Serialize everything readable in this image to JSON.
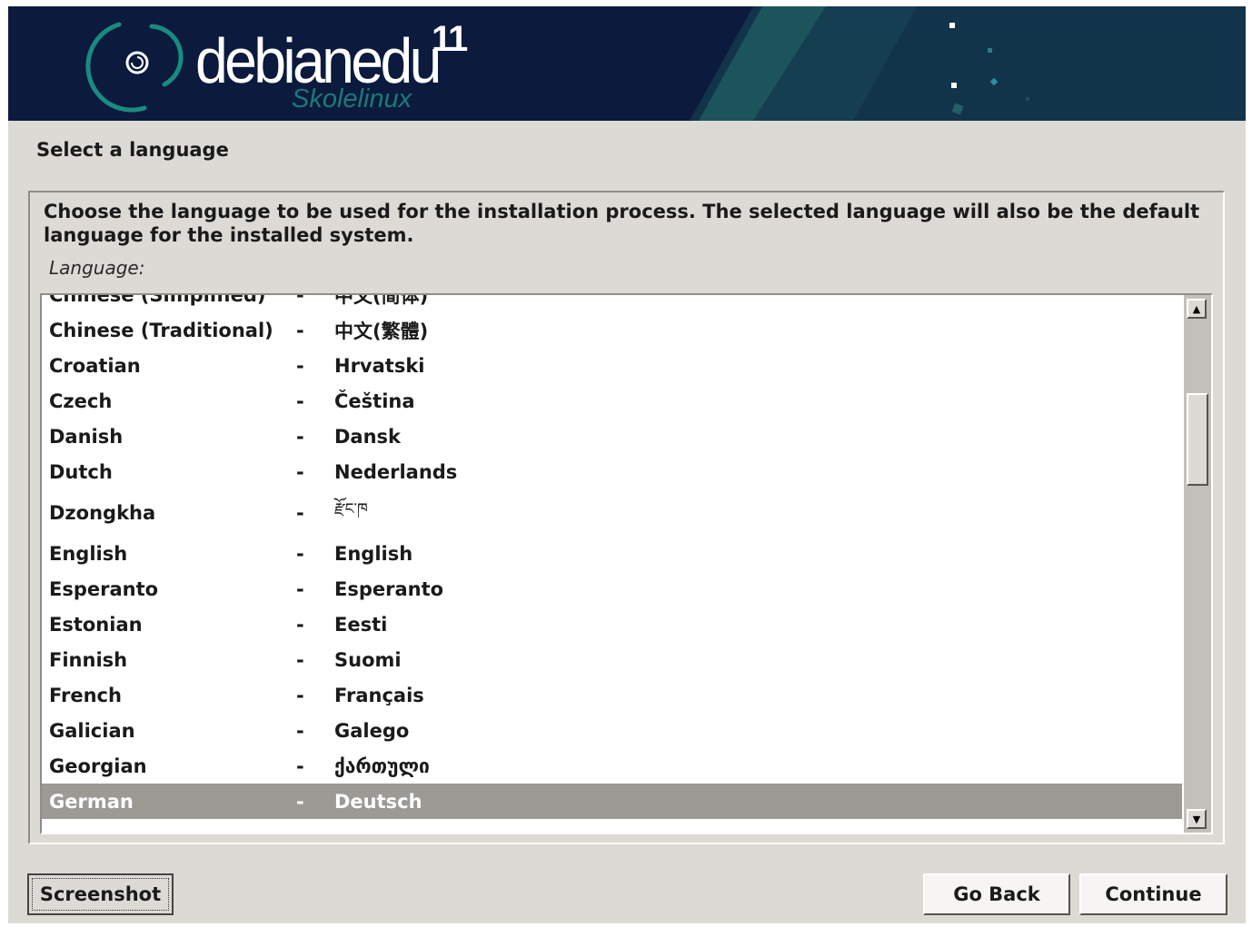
{
  "banner": {
    "logo_text": "debianedu",
    "logo_version": "11",
    "logo_subtitle": "Skolelinux"
  },
  "page_title": "Select a language",
  "description": "Choose the language to be used for the installation process. The selected language will also be the default language for the installed system.",
  "list_label": "Language:",
  "languages": [
    {
      "name": "Chinese (Simplified)",
      "native": "中文(简体)"
    },
    {
      "name": "Chinese (Traditional)",
      "native": "中文(繁體)"
    },
    {
      "name": "Croatian",
      "native": "Hrvatski"
    },
    {
      "name": "Czech",
      "native": "Čeština"
    },
    {
      "name": "Danish",
      "native": "Dansk"
    },
    {
      "name": "Dutch",
      "native": "Nederlands"
    },
    {
      "name": "Dzongkha",
      "native": "རྫོང་ཁ"
    },
    {
      "name": "English",
      "native": "English"
    },
    {
      "name": "Esperanto",
      "native": "Esperanto"
    },
    {
      "name": "Estonian",
      "native": "Eesti"
    },
    {
      "name": "Finnish",
      "native": "Suomi"
    },
    {
      "name": "French",
      "native": "Français"
    },
    {
      "name": "Galician",
      "native": "Galego"
    },
    {
      "name": "Georgian",
      "native": "ქართული"
    },
    {
      "name": "German",
      "native": "Deutsch"
    }
  ],
  "separator": "-",
  "selected_language": "German",
  "buttons": {
    "screenshot": "Screenshot",
    "go_back": "Go Back",
    "continue": "Continue"
  },
  "icons": {
    "scroll_up": "▲",
    "scroll_down": "▼"
  },
  "colors": {
    "banner_bg": "#0b1a3d",
    "accent_teal": "#1a7a78",
    "window_bg": "#dcdad5",
    "selected_row": "#9c9a95"
  }
}
